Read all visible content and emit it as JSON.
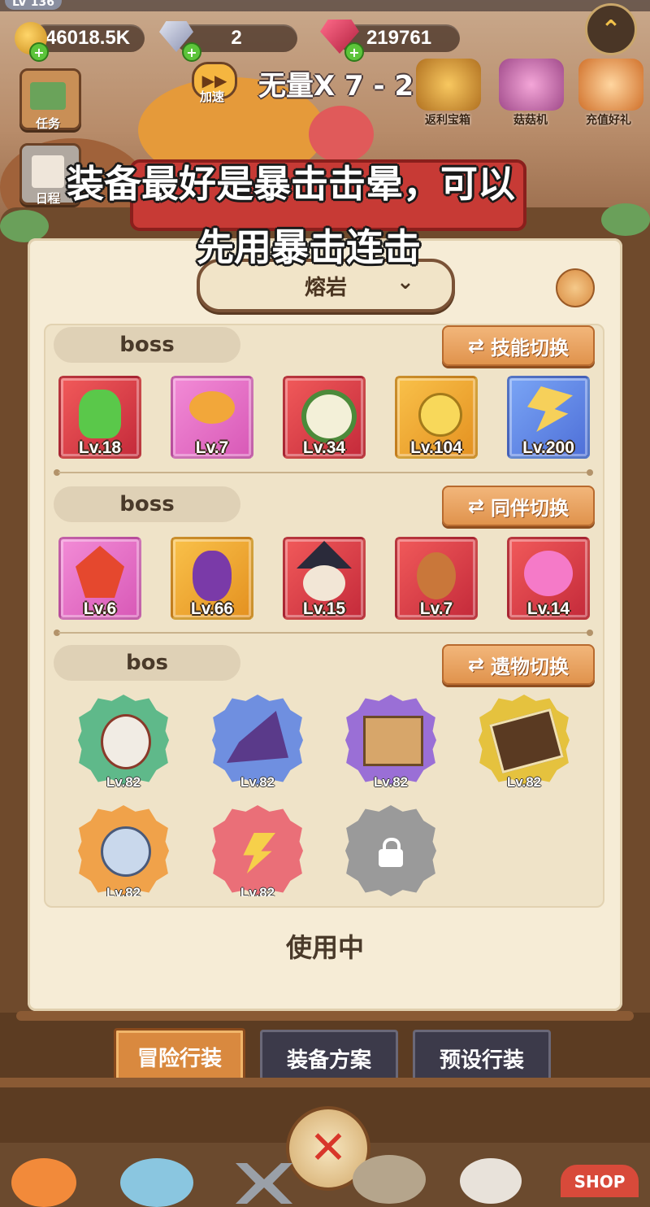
{
  "header": {
    "level": "LV 136",
    "currency": [
      {
        "name": "gold",
        "value": "46018.5K"
      },
      {
        "name": "diamond",
        "value": "2"
      },
      {
        "name": "gem",
        "value": "219761"
      }
    ],
    "speed_label": "加速",
    "stage_title": "无量X 7 - 2",
    "left_menu": [
      {
        "label": "任务"
      },
      {
        "label": "日程"
      }
    ],
    "shop_items": [
      {
        "label": "返利宝箱"
      },
      {
        "label": "菇菇机"
      },
      {
        "label": "充值好礼"
      }
    ]
  },
  "caption": {
    "line1": "装备最好是暴击击晕，可以",
    "line2": "先用暴击连击"
  },
  "panel": {
    "mode_selector": "熔岩",
    "skills": {
      "label": "boss",
      "switch_label": "技能切换",
      "items": [
        {
          "level": "Lv.18",
          "color": "#e8454f",
          "icon": "green-bean-icon"
        },
        {
          "level": "Lv.7",
          "color": "#ec79cf",
          "icon": "mushroom-icon"
        },
        {
          "level": "Lv.34",
          "color": "#e8454f",
          "icon": "cauliflower-icon"
        },
        {
          "level": "Lv.104",
          "color": "#f2ad34",
          "icon": "bomb-icon"
        },
        {
          "level": "Lv.200",
          "color": "#6b8fec",
          "icon": "lightning-mushroom-icon"
        }
      ]
    },
    "partners": {
      "label": "boss",
      "switch_label": "同伴切换",
      "items": [
        {
          "level": "Lv.6",
          "color": "#ec79cf",
          "icon": "dragon-icon"
        },
        {
          "level": "Lv.66",
          "color": "#f2ad34",
          "icon": "eggplant-icon"
        },
        {
          "level": "Lv.15",
          "color": "#e8454f",
          "icon": "witch-icon"
        },
        {
          "level": "Lv.7",
          "color": "#e8454f",
          "icon": "gingerbread-icon"
        },
        {
          "level": "Lv.14",
          "color": "#e8454f",
          "icon": "pink-cat-icon"
        }
      ]
    },
    "relics": {
      "label": "bos",
      "switch_label": "遗物切换",
      "items": [
        {
          "level": "Lv.82",
          "color": "#5fb98a",
          "icon": "skull-icon"
        },
        {
          "level": "Lv.82",
          "color": "#6f8fe0",
          "icon": "witch-hat-icon"
        },
        {
          "level": "Lv.82",
          "color": "#9a6fd6",
          "icon": "box-icon"
        },
        {
          "level": "Lv.82",
          "color": "#e5c23e",
          "icon": "book-icon"
        },
        {
          "level": "Lv.82",
          "color": "#f0a24a",
          "icon": "compass-icon"
        },
        {
          "level": "Lv.82",
          "color": "#ea6f78",
          "icon": "whip-icon"
        },
        {
          "level": "",
          "color": "#9a9a9a",
          "icon": "lock-icon"
        }
      ]
    },
    "status": "使用中"
  },
  "tabs": [
    {
      "label": "冒险行装",
      "active": true
    },
    {
      "label": "装备方案",
      "active": false
    },
    {
      "label": "预设行装",
      "active": false
    }
  ],
  "bottom_nav": {
    "shop_label": "SHOP"
  }
}
